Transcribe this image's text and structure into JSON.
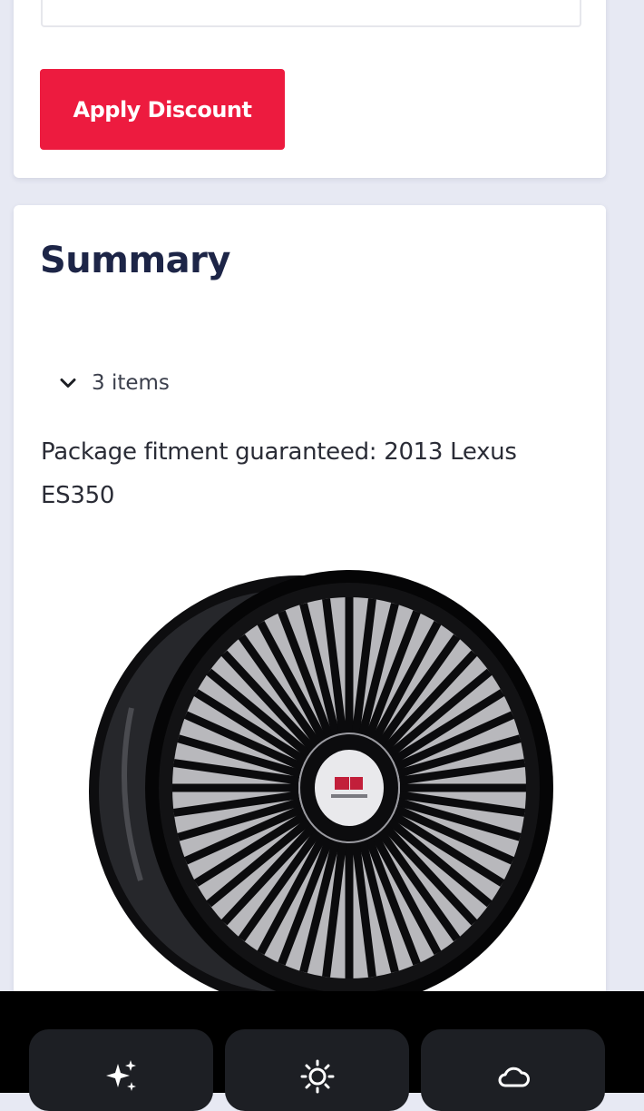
{
  "discount": {
    "apply_label": "Apply Discount"
  },
  "summary": {
    "title": "Summary",
    "items_toggle_label": "3 items",
    "fitment_text": "Package fitment guaranteed: 2013 Lexus ES350",
    "product_image": "black-wire-spoke-wheel"
  },
  "bottom_bar": {
    "buttons": [
      {
        "icon": "sparkles-icon"
      },
      {
        "icon": "brightness-icon"
      },
      {
        "icon": "cloud-icon"
      }
    ]
  },
  "colors": {
    "background": "#e7e9f3",
    "card": "#ffffff",
    "accent": "#ed1b3f",
    "title": "#1d2547",
    "bottom_bar": "#000000",
    "bottom_button": "#1d1f24"
  }
}
